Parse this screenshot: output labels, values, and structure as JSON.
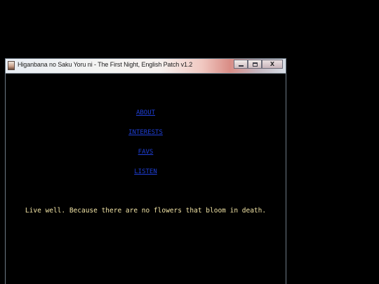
{
  "window": {
    "title": "Higanbana no Saku Yoru ni - The First Night, English Patch v1.2",
    "controls": {
      "minimize_icon": "minimize-icon",
      "maximize_icon": "maximize-icon",
      "close_label": "X"
    }
  },
  "nav": {
    "about": "ABOUT",
    "interests": "INTERESTS",
    "favs": "FAVS",
    "listen": "LISTEN"
  },
  "quote": "Live well. Because there are no flowers that bloom in death.",
  "colors": {
    "background": "#000000",
    "link": "#1f3fd6",
    "quote_text": "#f1e3a5"
  }
}
